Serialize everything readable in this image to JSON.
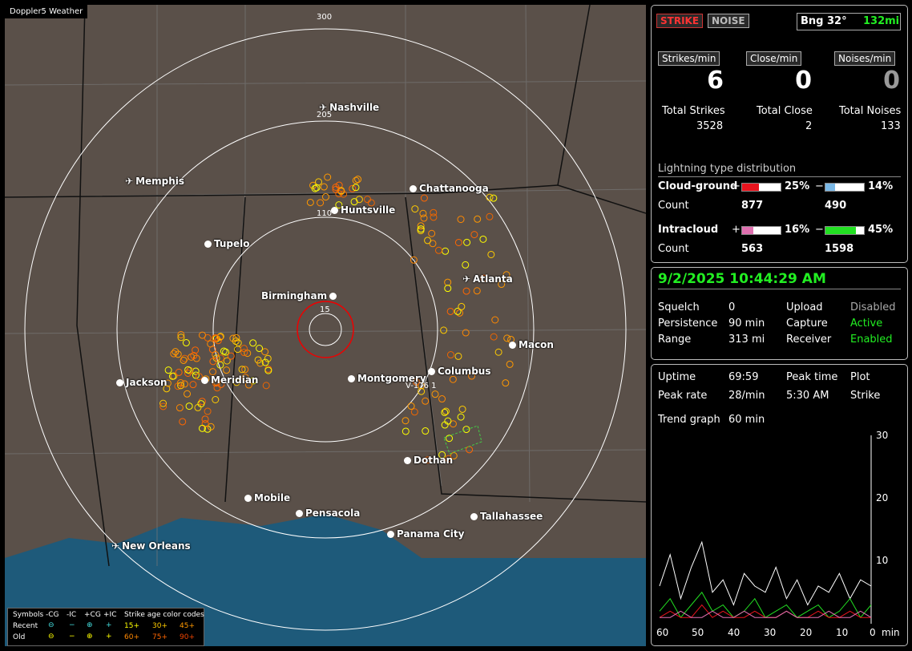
{
  "app": {
    "title": "Doppler5 Weather"
  },
  "map": {
    "ring_labels": [
      "300",
      "205",
      "110",
      "15"
    ],
    "cities": [
      {
        "name": "Nashville",
        "marker": "airport"
      },
      {
        "name": "Memphis",
        "marker": "airport"
      },
      {
        "name": "Chattanooga",
        "marker": "dot"
      },
      {
        "name": "Huntsville",
        "marker": "dot"
      },
      {
        "name": "Tupelo",
        "marker": "dot"
      },
      {
        "name": "Atlanta",
        "marker": "airport"
      },
      {
        "name": "Birmingham",
        "marker": "dot"
      },
      {
        "name": "Macon",
        "marker": "dot"
      },
      {
        "name": "Jackson",
        "marker": "dot"
      },
      {
        "name": "Meridian",
        "marker": "dot"
      },
      {
        "name": "Montgomery",
        "marker": "dot"
      },
      {
        "name": "Columbus",
        "marker": "dot"
      },
      {
        "name": "Dothan",
        "marker": "dot"
      },
      {
        "name": "Mobile",
        "marker": "dot"
      },
      {
        "name": "Pensacola",
        "marker": "dot"
      },
      {
        "name": "Tallahassee",
        "marker": "dot"
      },
      {
        "name": "Panama City",
        "marker": "dot"
      },
      {
        "name": "New Orleans",
        "marker": "airport"
      }
    ],
    "vector_label": "V-176",
    "vector_value": "1",
    "legend": {
      "symbols_label": "Symbols",
      "cols": [
        "-CG",
        "-IC",
        "+CG",
        "+IC"
      ],
      "recent_label": "Recent",
      "old_label": "Old",
      "age_title": "Strike age color codes",
      "recent_ages": [
        "15+",
        "30+",
        "45+"
      ],
      "old_ages": [
        "60+",
        "75+",
        "90+"
      ]
    }
  },
  "stats": {
    "strike_tab": "STRIKE",
    "noise_tab": "NOISE",
    "bearing": "Bng 32°",
    "distance": "132mi",
    "strikes_per_min_label": "Strikes/min",
    "close_per_min_label": "Close/min",
    "noises_per_min_label": "Noises/min",
    "strikes_per_min": "6",
    "close_per_min": "0",
    "noises_per_min": "0",
    "total_strikes_label": "Total Strikes",
    "total_close_label": "Total Close",
    "total_noises_label": "Total Noises",
    "total_strikes": "3528",
    "total_close": "2",
    "total_noises": "133",
    "dist_title": "Lightning type distribution",
    "cg_label": "Cloud-ground",
    "ic_label": "Intracloud",
    "count_label": "Count",
    "plus": "+",
    "minus": "−",
    "cg_pos_pct": "25%",
    "cg_neg_pct": "14%",
    "cg_pos_count": "877",
    "cg_neg_count": "490",
    "ic_pos_pct": "16%",
    "ic_neg_pct": "45%",
    "ic_pos_count": "563",
    "ic_neg_count": "1598",
    "cg_pos_frac": 0.25,
    "cg_neg_frac": 0.14,
    "ic_pos_frac": 0.16,
    "ic_neg_frac": 0.45,
    "colors": {
      "cg_pos": "#e8141e",
      "cg_neg": "#7ab8e6",
      "ic_pos": "#e070b0",
      "ic_neg": "#22e022"
    }
  },
  "status": {
    "datetime": "9/2/2025 10:44:29 AM",
    "squelch_label": "Squelch",
    "squelch": "0",
    "persistence_label": "Persistence",
    "persistence": "90 min",
    "range_label": "Range",
    "range": "313 mi",
    "upload_label": "Upload",
    "upload": "Disabled",
    "capture_label": "Capture",
    "capture": "Active",
    "receiver_label": "Receiver",
    "receiver": "Enabled"
  },
  "trend": {
    "uptime_label": "Uptime",
    "uptime": "69:59",
    "peak_time_label": "Peak time",
    "peak_time": "5:30 AM",
    "plot_label": "Plot",
    "plot": "Strike",
    "peak_rate_label": "Peak rate",
    "peak_rate": "28/min",
    "trend_graph_label": "Trend graph",
    "trend_graph": "60 min",
    "x_ticks": [
      "60",
      "50",
      "40",
      "30",
      "20",
      "10",
      "0"
    ],
    "x_unit": "min",
    "y_ticks": [
      "30",
      "20",
      "10"
    ]
  },
  "chart_data": {
    "type": "line",
    "xlabel": "min",
    "ylim": [
      0,
      30
    ],
    "x": [
      60,
      57,
      54,
      51,
      48,
      45,
      42,
      39,
      36,
      33,
      30,
      27,
      24,
      21,
      18,
      15,
      12,
      9,
      6,
      3,
      0
    ],
    "series": [
      {
        "color": "#ffffff",
        "values": [
          6,
          11,
          4,
          9,
          13,
          5,
          7,
          3,
          8,
          6,
          5,
          9,
          4,
          7,
          3,
          6,
          5,
          8,
          4,
          7,
          6
        ]
      },
      {
        "color": "#22e022",
        "values": [
          2,
          4,
          1,
          3,
          5,
          2,
          3,
          1,
          2,
          4,
          1,
          2,
          3,
          1,
          2,
          3,
          1,
          2,
          4,
          1,
          3
        ]
      },
      {
        "color": "#e8141e",
        "values": [
          1,
          2,
          1,
          1,
          3,
          1,
          2,
          1,
          1,
          2,
          1,
          1,
          2,
          1,
          1,
          2,
          1,
          1,
          2,
          1,
          1
        ]
      },
      {
        "color": "#e070b0",
        "values": [
          1,
          1,
          2,
          1,
          1,
          2,
          1,
          1,
          2,
          1,
          1,
          1,
          2,
          1,
          1,
          1,
          2,
          1,
          1,
          2,
          1
        ]
      }
    ]
  }
}
